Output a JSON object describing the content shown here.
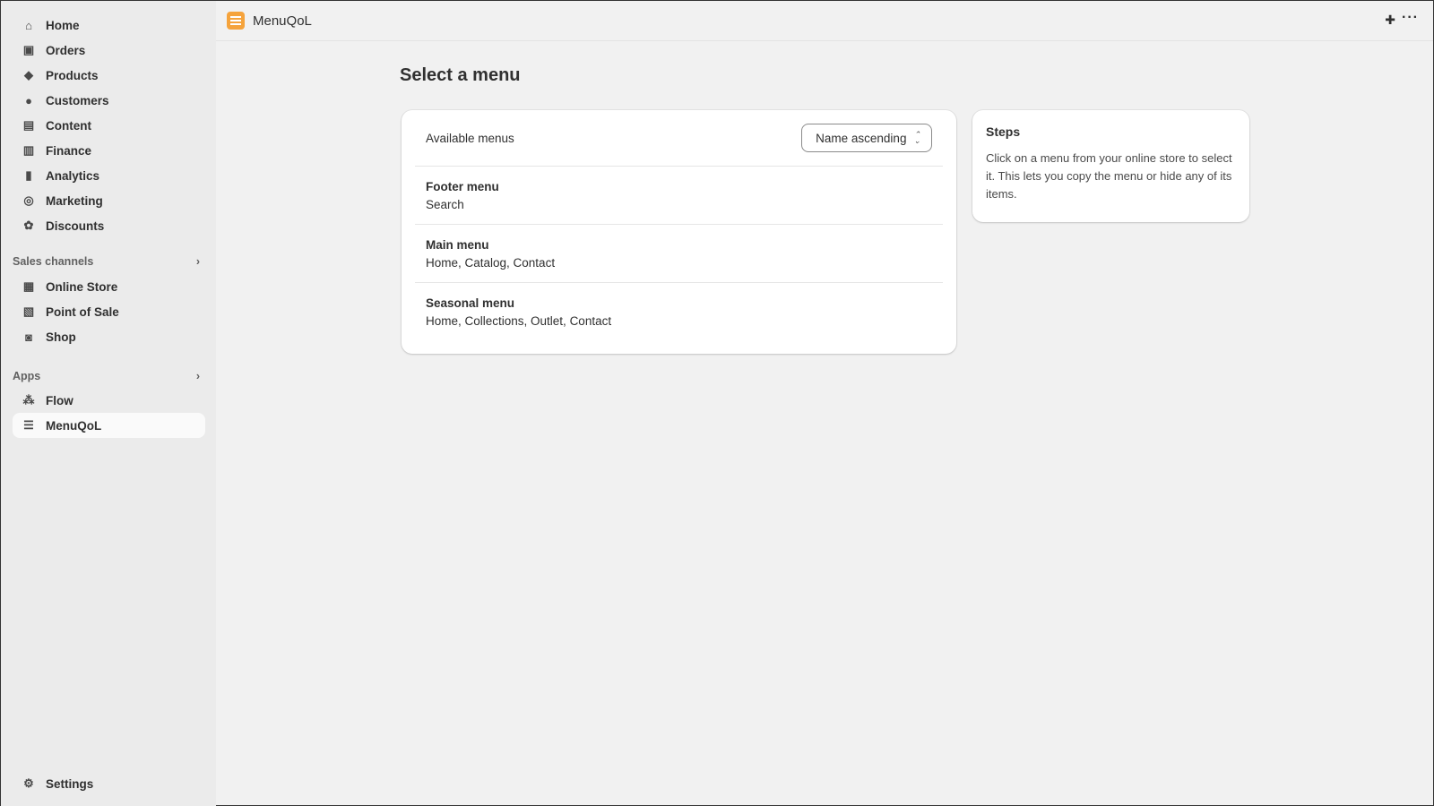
{
  "sidebar": {
    "items": [
      {
        "label": "Home",
        "icon": "home-icon",
        "glyph": "⌂"
      },
      {
        "label": "Orders",
        "icon": "inbox-icon",
        "glyph": "▣"
      },
      {
        "label": "Products",
        "icon": "tag-icon",
        "glyph": "◆"
      },
      {
        "label": "Customers",
        "icon": "person-icon",
        "glyph": "●"
      },
      {
        "label": "Content",
        "icon": "image-icon",
        "glyph": "▤"
      },
      {
        "label": "Finance",
        "icon": "bank-icon",
        "glyph": "▥"
      },
      {
        "label": "Analytics",
        "icon": "bar-chart-icon",
        "glyph": "▮"
      },
      {
        "label": "Marketing",
        "icon": "target-icon",
        "glyph": "◎"
      },
      {
        "label": "Discounts",
        "icon": "discount-icon",
        "glyph": "✿"
      }
    ],
    "sales_channels": {
      "title": "Sales channels",
      "items": [
        {
          "label": "Online Store",
          "icon": "store-icon",
          "glyph": "▦"
        },
        {
          "label": "Point of Sale",
          "icon": "pos-icon",
          "glyph": "▧"
        },
        {
          "label": "Shop",
          "icon": "shop-icon",
          "glyph": "◙"
        }
      ]
    },
    "apps": {
      "title": "Apps",
      "items": [
        {
          "label": "Flow",
          "icon": "flow-icon",
          "glyph": "⁂"
        },
        {
          "label": "MenuQoL",
          "icon": "menuqol-icon",
          "glyph": "☰"
        }
      ]
    },
    "settings": {
      "label": "Settings",
      "icon": "gear-icon",
      "glyph": "⚙"
    }
  },
  "topbar": {
    "title": "MenuQoL",
    "pin": "📌",
    "more": "···"
  },
  "page": {
    "title": "Select a menu"
  },
  "menus": {
    "header": "Available menus",
    "sort": "Name ascending",
    "items": [
      {
        "name": "Footer menu",
        "links": "Search"
      },
      {
        "name": "Main menu",
        "links": "Home, Catalog, Contact"
      },
      {
        "name": "Seasonal menu",
        "links": "Home, Collections, Outlet, Contact"
      }
    ]
  },
  "steps": {
    "title": "Steps",
    "text": "Click on a menu from your online store to select it. This lets you copy the menu or hide any of its items."
  },
  "colors": {
    "accent": "#f5a33c"
  }
}
